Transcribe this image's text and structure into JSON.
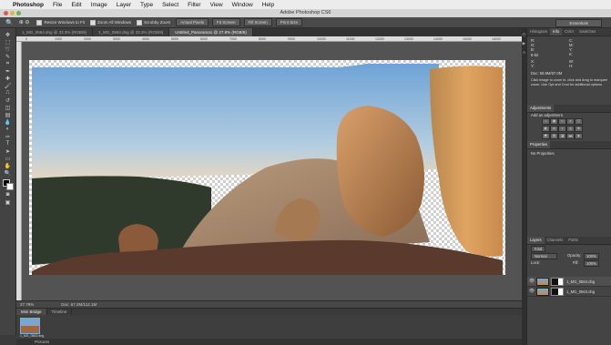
{
  "menubar": {
    "app": "Photoshop",
    "items": [
      "File",
      "Edit",
      "Image",
      "Layer",
      "Type",
      "Select",
      "Filter",
      "View",
      "Window",
      "Help"
    ]
  },
  "window_title": "Adobe Photoshop CS6",
  "options_bar": {
    "resize_windows": "Resize Windows to Fit",
    "zoom_all": "Zoom All Windows",
    "scrubby_zoom": "Scrubby Zoom",
    "actual_pixels": "Actual Pixels",
    "fit_screen": "Fit Screen",
    "fill_screen": "Fill Screen",
    "print_size": "Print Size",
    "workspace": "Essentials"
  },
  "tabs": [
    {
      "label": "1_MG_0564.dng @ 33.3% (RGB/8)"
    },
    {
      "label": "1_MG_0563.dng @ 33.3% (RGB/8)"
    },
    {
      "label": "Untitled_Panorama1 @ 27.8% (RGB/8)"
    }
  ],
  "ruler_ticks": [
    "0",
    "1000",
    "2000",
    "3000",
    "4000",
    "5000",
    "6000",
    "7000",
    "8000",
    "9000",
    "10000",
    "11000",
    "12000",
    "13000",
    "14000",
    "15000",
    "16000"
  ],
  "status": {
    "zoom": "27.78%",
    "doc": "Doc: 67.2M/112.1M"
  },
  "bottom_tabs": [
    "Mini Bridge",
    "Timeline"
  ],
  "bridge": {
    "thumb_label": "1_MG_0563.dng",
    "path": "Pictures"
  },
  "panels": {
    "top_tabs": [
      "Histogram",
      "Info",
      "Color",
      "Swatches"
    ],
    "info": {
      "r": "R:",
      "g": "G:",
      "b": "B:",
      "c": "C:",
      "m": "M:",
      "y": "Y:",
      "k": "K:",
      "bit": "8-bit",
      "x": "X:",
      "y_coord": "Y:",
      "w": "W:",
      "h": "H:",
      "doc": "Doc: 58.9M/67.0M",
      "hint": "Click image to zoom in, click and drag to marquee zoom. Use Opt and Cmd for additional options."
    },
    "adjustments": {
      "title": "Adjustments",
      "subtitle": "Add an adjustment"
    },
    "properties": {
      "title": "Properties",
      "content": "No Properties"
    },
    "layers": {
      "tabs": [
        "Layers",
        "Channels",
        "Paths"
      ],
      "kind": "Kind",
      "blend": "Normal",
      "opacity_label": "Opacity:",
      "opacity": "100%",
      "lock_label": "Lock:",
      "fill_label": "Fill:",
      "fill": "100%",
      "items": [
        {
          "name": "1_MG_0564.dng"
        },
        {
          "name": "1_MG_0563.dng"
        }
      ]
    }
  },
  "colors": {
    "menubar": "#ececec",
    "ui_dark": "#3b3b3b",
    "pasteboard": "#535353",
    "sky_top": "#6fa4d6",
    "rock": "#c08a4a"
  }
}
